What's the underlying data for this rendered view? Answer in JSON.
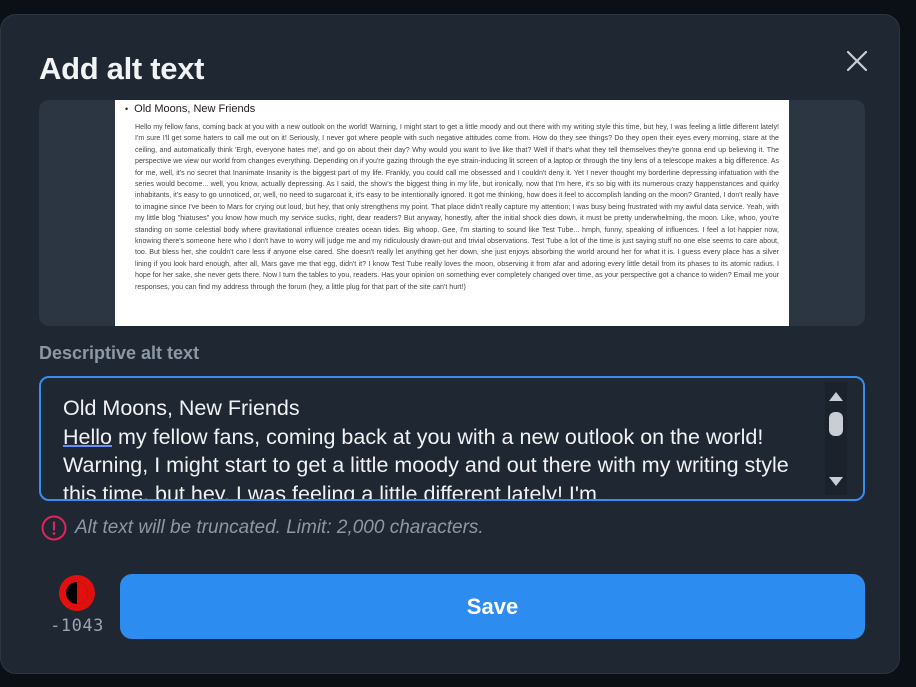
{
  "dialog": {
    "title": "Add alt text",
    "close_icon": "close-icon"
  },
  "preview": {
    "heading": "Old Moons, New Friends",
    "body": "Hello my fellow fans, coming back at you with a new outlook on the world! Warning, I might start to get a little moody and out there with my writing style this time, but hey, I was feeling a little different lately! I'm sure I'll get some haters to call me out on it! Seriously, I never got where people with such negative attitudes come from. How do they see things? Do they open their eyes every morning, stare at the ceiling, and automatically think 'Ergh, everyone hates me', and go on about their day? Why would you want to live like that? Well if that's what they tell themselves they're gonna end up believing it. The perspective we view our world from changes everything. Depending on if you're gazing through the eye strain-inducing lit screen of a laptop or through the tiny lens of a telescope makes a big difference. As for me, well, it's no secret that Inanimate Insanity is the biggest part of my life. Frankly, you could call me obsessed and I couldn't deny it. Yet I never thought my borderline depressing infatuation with the series would become... well, you know, actually depressing. As I said, the show's the biggest thing in my life, but ironically, now that I'm here, it's so big with its numerous crazy happenstances and quirky inhabitants, it's easy to go unnoticed, or, well, no need to sugarcoat it, it's easy to be intentionally ignored. It got me thinking, how does it feel to accomplish landing on the moon? Granted, I don't really have to imagine since I've been to Mars for crying out loud, but hey, that only strengthens my point. That place didn't really capture my attention; I was busy being frustrated with my awful data service. Yeah, with my little blog \"hiatuses\" you know how much my service sucks, right, dear readers? But anyway, honestly, after the initial shock dies down, it must be pretty underwhelming, the moon. Like, whoo, you're standing on some celestial body where gravitational influence creates ocean tides. Big whoop. Gee, I'm starting to sound like Test Tube... hmph, funny, speaking of influences. I feel a lot happier now, knowing there's someone here who I don't have to worry will judge me and my ridiculously drawn-out and trivial observations. Test Tube a lot of the time is just saying stuff no one else seems to care about, too. But bless her, she couldn't care less if anyone else cared. She doesn't really let anything get her down, she just enjoys absorbing the world around her for what it is. I guess every place has a silver lining if you look hard enough, after all, Mars gave me that egg, didn't it? I know Test Tube really loves the moon, observing it from afar and adoring every little detail from its phases to its atomic radius. I hope for her sake, she never gets there. Now I turn the tables to you, readers. Has your opinion on something ever completely changed over time, as your perspective got a chance to widen? Email me your responses, you can find my address through the forum (hey, a little plug for that part of the site can't hurt!)"
  },
  "field": {
    "label": "Descriptive alt text",
    "line1": "Old Moons, New Friends",
    "first_word": "Hello",
    "rest": " my fellow fans, coming back at you with a new outlook on the world! Warning, I might start to get a little moody and out there with my writing style this time, but hey, I was feeling a little different lately! I'm"
  },
  "warning": {
    "icon": "info-circle-icon",
    "text": "Alt text will be truncated. Limit: 2,000 characters.",
    "color": "#e0245e"
  },
  "counter": {
    "value": "-1043",
    "color": "#e0100f"
  },
  "actions": {
    "save_label": "Save",
    "accent": "#2d8cf0"
  }
}
